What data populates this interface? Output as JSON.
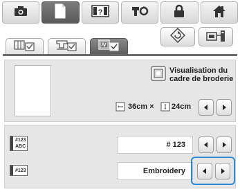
{
  "top_tabs": [
    {
      "icon": "camera-icon"
    },
    {
      "icon": "document-icon"
    },
    {
      "icon": "help-icon"
    },
    {
      "icon": "machine-settings-icon"
    },
    {
      "icon": "lock-icon"
    },
    {
      "icon": "home-icon"
    }
  ],
  "frame_display": {
    "title_line1": "Visualisation du",
    "title_line2": "cadre de broderie",
    "width_value": "36",
    "height_value": "24",
    "unit": "cm",
    "separator": "×"
  },
  "thread_number": {
    "value": "# 123",
    "icon_top": "#123",
    "icon_bottom": "ABC"
  },
  "thread_brand": {
    "value": "Embroidery",
    "icon_text": "#123"
  }
}
